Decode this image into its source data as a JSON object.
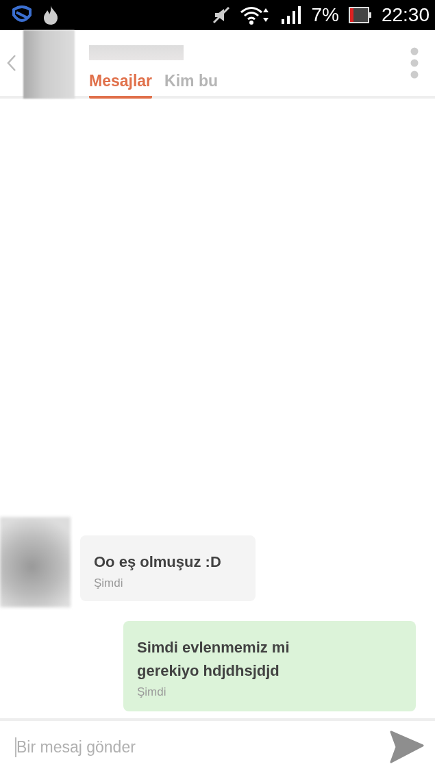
{
  "status_bar": {
    "battery": "7%",
    "time": "22:30"
  },
  "header": {
    "tabs": [
      {
        "label": "Mesajlar",
        "selected": true
      },
      {
        "label": "Kim bu",
        "selected": false
      }
    ]
  },
  "messages": [
    {
      "kind": "incoming",
      "text": "Oo eş olmuşuz :D",
      "time": "Şimdi"
    },
    {
      "kind": "outgoing",
      "text": "Simdi evlenmemiz mi gerekiyo hdjdhsjdjd",
      "time": "Şimdi"
    }
  ],
  "composer": {
    "placeholder": "Bir mesaj gönder"
  }
}
